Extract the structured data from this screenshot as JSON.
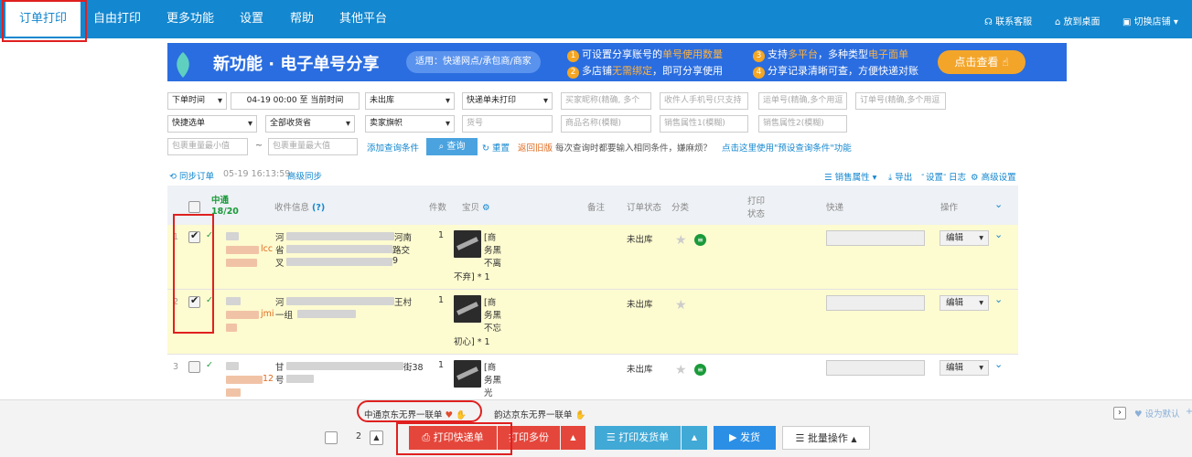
{
  "nav": {
    "tabs": [
      "订单打印",
      "自由打印",
      "更多功能",
      "设置",
      "帮助",
      "其他平台"
    ],
    "right": {
      "service": "联系客服",
      "desktop": "放到桌面",
      "switch_shop": "切换店铺"
    }
  },
  "banner": {
    "title": "新功能 · 电子单号分享",
    "applies": "适用：快递网点/承包商/商家",
    "f1": {
      "num": "1",
      "pre": "可设置分享账号的",
      "hl": "单号使用数量",
      "post": ""
    },
    "f2": {
      "num": "2",
      "pre": "多店铺",
      "hl": "无需绑定",
      "post": "，即可分享使用"
    },
    "f3": {
      "num": "3",
      "pre": "支持",
      "hl": "多平台",
      "mid": "，多种类型",
      "hl2": "电子面单"
    },
    "f4": {
      "num": "4",
      "pre": "分享记录清晰可查，方便快递对账"
    },
    "cta": "点击查看"
  },
  "filters": {
    "time_type": "下单时间",
    "date_range": "04-19 00:00 至 当前时间",
    "stock": "未出库",
    "print_status": "快递单未打印",
    "buyer_ph": "买家昵称(精确, 多个",
    "phone_ph": "收件人手机号(只支持",
    "waybill_ph": "运单号(精确,多个用逗",
    "order_ph": "订单号(精确,多个用逗",
    "quick_select": "快捷选单",
    "province": "全部收货省",
    "seller_flag": "卖家旗帜",
    "goods_no_ph": "货号",
    "goods_name_ph": "商品名称(模糊)",
    "attr1_ph": "销售属性1(模糊)",
    "attr2_ph": "销售属性2(模糊)",
    "weight_min_ph": "包裹重量最小值",
    "tilde": "~",
    "weight_max_ph": "包裹重量最大值",
    "add_condition": "添加查询条件",
    "query_btn": "查询",
    "reset": "重置",
    "old_version": "返回旧版",
    "tip": "每次查询时都要输入相同条件，嫌麻烦？",
    "tip_link": "点击这里使用\"预设查询条件\"功能"
  },
  "sync": {
    "label": "同步订单",
    "time": "05-19 16:13:59",
    "advanced": "高级同步",
    "sales_attr": "销售属性",
    "export": "导出",
    "settings": "设置",
    "log": "日志",
    "adv_settings": "高级设置"
  },
  "table": {
    "courier": "中通",
    "count": "18/20",
    "headers": {
      "recipient": "收件信息",
      "help": "(?)",
      "qty": "件数",
      "items": "宝贝",
      "note": "备注",
      "order_status": "订单状态",
      "category": "分类",
      "print": "打印",
      "print2": "状态",
      "express": "快递",
      "ops": "操作"
    },
    "rows": [
      {
        "idx": "1",
        "checked": true,
        "addr_tail": "河南",
        "addr_l2a": "省",
        "addr_l2b": "路交",
        "addr_l3a": "叉",
        "addr_l3b": "9",
        "nick_tail": "lcc",
        "qty": "1",
        "item_1": "[商",
        "item_2": "务黑",
        "item_3": "不离",
        "item_4": "不弃] * 1",
        "status": "未出库",
        "edit": "编辑"
      },
      {
        "idx": "2",
        "checked": true,
        "addr_tail": "王村",
        "addr_l2a": "一组",
        "addr_l2b": "",
        "addr_l3a": "",
        "addr_l3b": "",
        "nick_tail": "jmi",
        "qty": "1",
        "item_1": "[商",
        "item_2": "务黑",
        "item_3": "不忘",
        "item_4": "初心] * 1",
        "status": "未出库",
        "edit": "编辑"
      },
      {
        "idx": "3",
        "checked": false,
        "addr_tail": "街38",
        "addr_l2a": "号",
        "addr_l2b": "",
        "addr_l3a": "",
        "addr_l3b": "",
        "nick_tail": "12",
        "qty": "1",
        "item_1": "[商",
        "item_2": "务黑",
        "item_3": "光",
        "item_4": "",
        "status": "未出库",
        "edit": "编辑"
      }
    ]
  },
  "bottom": {
    "tpl1": "中通京东无界一联单",
    "tpl2": "韵达京东无界一联单",
    "set_default": "设为默认",
    "copies": "2",
    "print_express": "打印快递单",
    "print_multi": "打印多份",
    "print_invoice": "打印发货单",
    "ship": "发货",
    "batch": "批量操作"
  },
  "colors": {
    "nav": "#1387cf",
    "banner": "#2a6de0",
    "accent_orange": "#f3a52a",
    "print_red": "#e5463b",
    "teal": "#41a9d6",
    "highlight_box": "#e02020"
  }
}
